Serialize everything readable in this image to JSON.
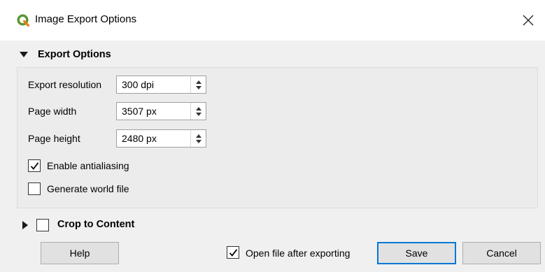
{
  "window": {
    "title": "Image Export Options",
    "app_icon": "qgis-logo-icon",
    "close_icon": "close-icon"
  },
  "export_options": {
    "group_label": "Export Options",
    "expanded": true,
    "fields": [
      {
        "label": "Export resolution",
        "value": "300 dpi"
      },
      {
        "label": "Page width",
        "value": "3507 px"
      },
      {
        "label": "Page height",
        "value": "2480 px"
      }
    ],
    "checkboxes": [
      {
        "label": "Enable antialiasing",
        "checked": true
      },
      {
        "label": "Generate world file",
        "checked": false
      }
    ]
  },
  "crop_to_content": {
    "label": "Crop to Content",
    "expanded": false,
    "checked": false
  },
  "footer": {
    "help_label": "Help",
    "open_after_label": "Open file after exporting",
    "open_after_checked": true,
    "save_label": "Save",
    "cancel_label": "Cancel"
  },
  "colors": {
    "qgis_green": "#589632",
    "qgis_yellow": "#ee7913",
    "primary_border": "#0078d7"
  }
}
